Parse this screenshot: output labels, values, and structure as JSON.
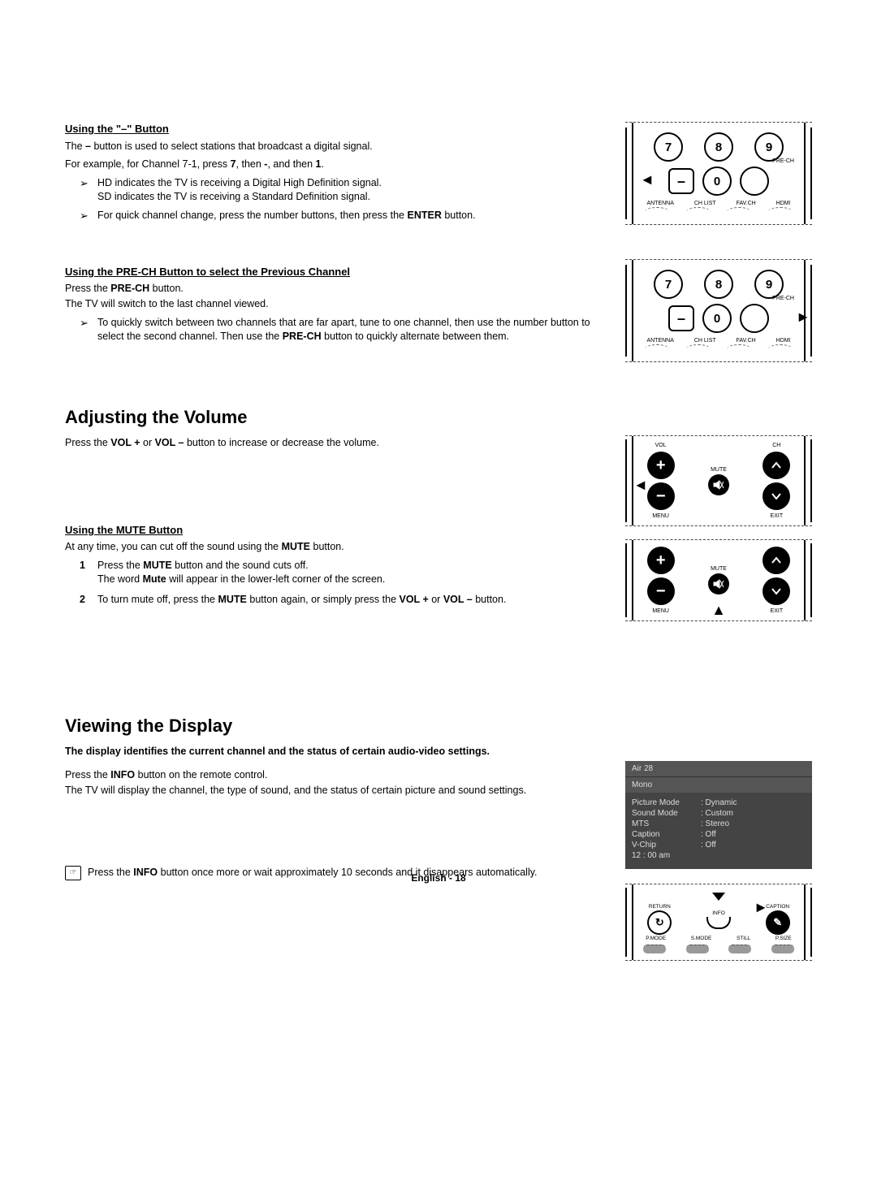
{
  "section1": {
    "heading": "Using the \"–\" Button",
    "p1_a": "The ",
    "p1_b": "–",
    "p1_c": " button is used to select stations that broadcast a digital signal.",
    "p2_a": "For example, for Channel 7-1, press ",
    "p2_b": "7",
    "p2_c": ", then ",
    "p2_d": "-",
    "p2_e": ", and then ",
    "p2_f": "1",
    "p2_g": ".",
    "li1": "HD indicates the TV is receiving a Digital High Definition signal.\nSD indicates the TV is receiving a Standard Definition signal.",
    "li2_a": "For quick channel change, press the number buttons, then press the ",
    "li2_b": "ENTER",
    "li2_c": " button."
  },
  "section2": {
    "heading": "Using the PRE-CH Button to select the Previous Channel",
    "p1_a": "Press the ",
    "p1_b": "PRE-CH",
    "p1_c": " button.",
    "p2": "The TV will switch to the last channel viewed.",
    "li1_a": "To quickly switch between two channels that are far apart, tune to one channel, then use the number button to select the second channel. Then use the ",
    "li1_b": "PRE-CH",
    "li1_c": " button to quickly alternate between them."
  },
  "section3": {
    "title": "Adjusting the Volume",
    "p1_a": "Press the ",
    "p1_b": "VOL +",
    "p1_c": " or ",
    "p1_d": "VOL –",
    "p1_e": " button to increase or decrease the volume."
  },
  "section4": {
    "heading": "Using the MUTE Button",
    "p1_a": "At any time, you can cut off the sound using the ",
    "p1_b": "MUTE",
    "p1_c": " button.",
    "li1_a": "Press the ",
    "li1_b": "MUTE",
    "li1_c": " button and the sound cuts off.\nThe word ",
    "li1_d": "Mute",
    "li1_e": " will appear in the lower-left corner of the screen.",
    "li2_a": "To turn mute off, press the ",
    "li2_b": "MUTE",
    "li2_c": " button again, or simply press the ",
    "li2_d": "VOL +",
    "li2_e": " or ",
    "li2_f": "VOL –",
    "li2_g": " button."
  },
  "section5": {
    "title": "Viewing the Display",
    "intro": "The display identifies the current channel and the status of certain audio-video settings.",
    "p1_a": "Press the ",
    "p1_b": "INFO",
    "p1_c": " button on the remote control.",
    "p2": "The TV will display the channel, the type of sound, and the status of certain picture and sound settings.",
    "note_a": "Press the ",
    "note_b": "INFO",
    "note_c": " button once more or wait approximately 10 seconds and it disappears automatically."
  },
  "remote_num": {
    "n7": "7",
    "n8": "8",
    "n9": "9",
    "dash": "–",
    "n0": "0",
    "prech": "PRE-CH",
    "antenna": "ANTENNA",
    "chlist": "CH LIST",
    "favch": "FAV.CH",
    "hdmi": "HDMI"
  },
  "remote_vol": {
    "vol": "VOL",
    "ch": "CH",
    "mute": "MUTE",
    "menu": "MENU",
    "exit": "EXIT"
  },
  "osd": {
    "channel": "Air 28",
    "sound": "Mono",
    "rows": [
      {
        "k": "Picture Mode",
        "v": ": Dynamic"
      },
      {
        "k": "Sound Mode",
        "v": ": Custom"
      },
      {
        "k": "MTS",
        "v": ": Stereo"
      },
      {
        "k": "Caption",
        "v": ": Off"
      },
      {
        "k": "V-Chip",
        "v": ": Off"
      }
    ],
    "time": "12 : 00 am"
  },
  "remote_info": {
    "return": "RETURN",
    "info": "INFO",
    "caption": "CAPTION",
    "pmode": "P.MODE",
    "smode": "S.MODE",
    "still": "STILL",
    "psize": "P.SIZE"
  },
  "num_labels": {
    "one": "1",
    "two": "2"
  },
  "footer": "English - 18"
}
